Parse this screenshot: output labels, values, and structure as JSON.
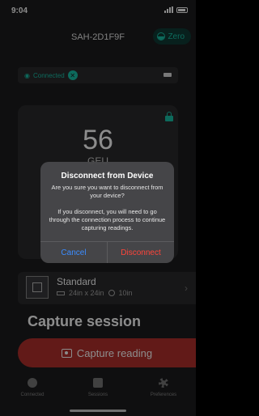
{
  "status_bar": {
    "time": "9:04"
  },
  "header": {
    "device_name": "SAH-2D1F9F",
    "zero_label": "Zero"
  },
  "connection": {
    "label": "Connected"
  },
  "reading": {
    "value": "56",
    "unit": "GEU"
  },
  "surface": {
    "name": "Standard",
    "dimensions": "24in x 24in",
    "timer": "10in"
  },
  "session": {
    "title": "Capture session",
    "capture_label": "Capture reading"
  },
  "tabs": [
    {
      "label": "Connected",
      "icon": "bluetooth-icon"
    },
    {
      "label": "Sessions",
      "icon": "document-icon"
    },
    {
      "label": "Preferences",
      "icon": "gear-icon"
    }
  ],
  "alert": {
    "title": "Disconnect from Device",
    "message": "Are you sure you want to disconnect from your device?",
    "detail": "If you disconnect, you will need to go through the connection process to continue capturing readings.",
    "cancel_label": "Cancel",
    "confirm_label": "Disconnect"
  },
  "colors": {
    "accent": "#19c1a8",
    "danger": "#ff453a",
    "capture": "#b3302d",
    "link": "#3b8cff"
  }
}
